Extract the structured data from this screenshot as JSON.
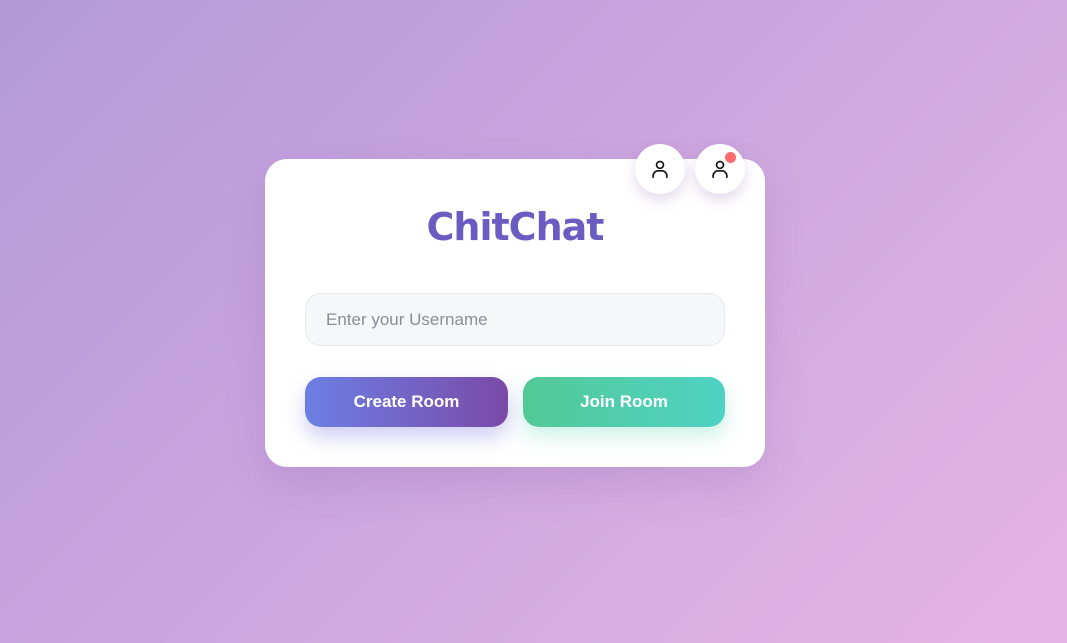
{
  "app": {
    "title": "ChitChat"
  },
  "icons": {
    "profile": "user-icon",
    "notifications_profile": "user-icon",
    "notification_dot_color": "#ff6b6b"
  },
  "form": {
    "username_placeholder": "Enter your Username",
    "username_value": ""
  },
  "actions": {
    "create_label": "Create Room",
    "join_label": "Join Room"
  },
  "colors": {
    "brand": "#6a5cc0",
    "create_gradient": [
      "#6c7fe3",
      "#7a4aa8"
    ],
    "join_gradient": [
      "#52c996",
      "#4fd2c4"
    ]
  }
}
